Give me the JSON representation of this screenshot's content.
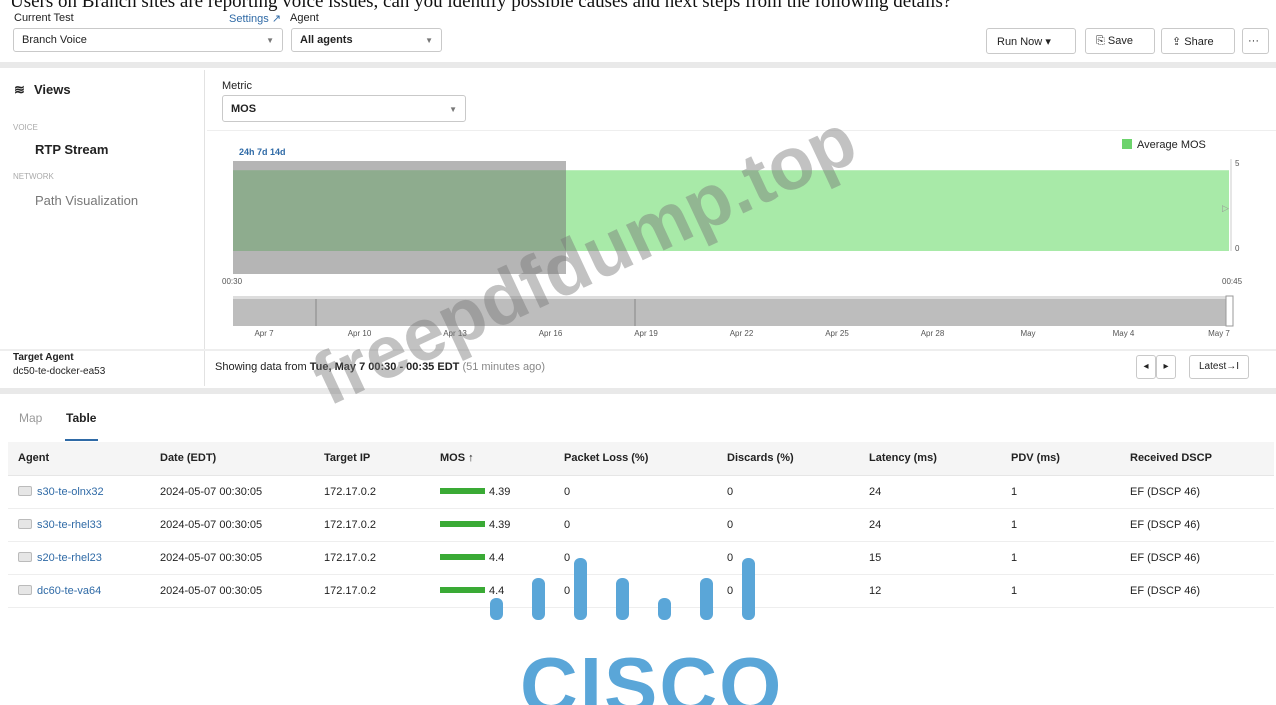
{
  "question": "Users on Branch sites are reporting voice issues, can you identify possible causes and next steps from the following details?",
  "header": {
    "current_test_label": "Current Test",
    "current_test_value": "Branch Voice",
    "settings_link": "Settings",
    "agent_label": "Agent",
    "agent_value": "All agents",
    "run_now": "Run Now",
    "save": "Save",
    "share": "Share",
    "more": "···"
  },
  "sidebar": {
    "views_title": "Views",
    "voice_section": "VOICE",
    "rtp_stream": "RTP Stream",
    "network_section": "NETWORK",
    "path_visualization": "Path Visualization",
    "target_agent_label": "Target Agent",
    "target_agent_value": "dc50-te-docker-ea53"
  },
  "metric": {
    "label": "Metric",
    "value": "MOS"
  },
  "chart": {
    "range_buttons": "24h  7d  14d",
    "legend": "Average MOS",
    "y_max": "5",
    "y_min": "0",
    "x_start": "00:30",
    "x_end": "00:45",
    "timeline_labels": [
      "Apr 7",
      "Apr 10",
      "Apr 13",
      "Apr 16",
      "Apr 19",
      "Apr 22",
      "Apr 25",
      "Apr 28",
      "May",
      "May 4",
      "May 7"
    ],
    "series_color": "#a8eaa8"
  },
  "chart_data": {
    "type": "area",
    "title": "",
    "series": [
      {
        "name": "Average MOS",
        "values": [
          4.39
        ]
      }
    ],
    "ylim": [
      0,
      5
    ],
    "xlabel": "",
    "ylabel": ""
  },
  "status": {
    "showing_prefix": "Showing data from ",
    "showing_range": "Tue, May 7 00:30 - 00:35 EDT",
    "showing_ago": "(51 minutes ago)",
    "prev": "◂",
    "next": "▸",
    "latest": "Latest→I"
  },
  "tabs": {
    "map": "Map",
    "table": "Table"
  },
  "table": {
    "headers": [
      "Agent",
      "Date (EDT)",
      "Target IP",
      "MOS ↑",
      "Packet Loss (%)",
      "Discards (%)",
      "Latency (ms)",
      "PDV (ms)",
      "Received DSCP"
    ],
    "rows": [
      [
        "s30-te-olnx32",
        "2024-05-07 00:30:05",
        "172.17.0.2",
        "4.39",
        "0",
        "0",
        "24",
        "1",
        "EF (DSCP 46)"
      ],
      [
        "s30-te-rhel33",
        "2024-05-07 00:30:05",
        "172.17.0.2",
        "4.39",
        "0",
        "0",
        "24",
        "1",
        "EF (DSCP 46)"
      ],
      [
        "s20-te-rhel23",
        "2024-05-07 00:30:05",
        "172.17.0.2",
        "4.4",
        "0",
        "0",
        "15",
        "1",
        "EF (DSCP 46)"
      ],
      [
        "dc60-te-va64",
        "2024-05-07 00:30:05",
        "172.17.0.2",
        "4.4",
        "0",
        "0",
        "12",
        "1",
        "EF (DSCP 46)"
      ]
    ]
  },
  "overlay": {
    "watermark": "freepdfdump.top",
    "logo": "CISCO"
  }
}
